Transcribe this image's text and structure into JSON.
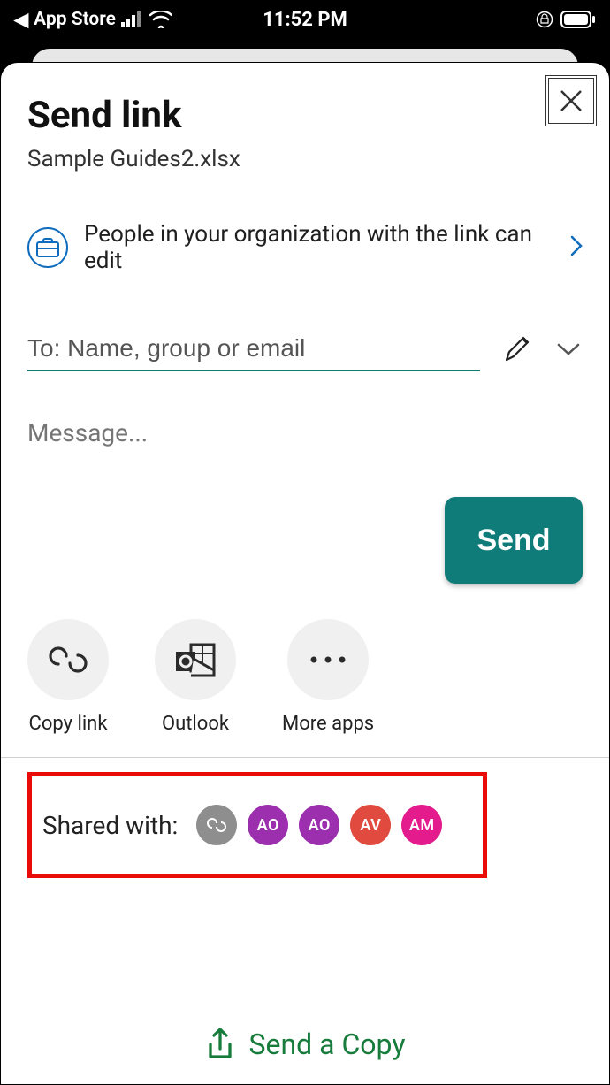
{
  "statusbar": {
    "back_label": "App Store",
    "time": "11:52 PM"
  },
  "sheet": {
    "title": "Send link",
    "filename": "Sample Guides2.xlsx",
    "permission_text": "People in your organization with the link can edit",
    "to_placeholder": "To: Name, group or email",
    "message_placeholder": "Message...",
    "send_label": "Send"
  },
  "actions": {
    "copy_link": "Copy link",
    "outlook": "Outlook",
    "more_apps": "More apps"
  },
  "shared": {
    "label": "Shared with:",
    "avatars": [
      {
        "type": "link",
        "text": "",
        "bg": "#8e8e8e"
      },
      {
        "type": "initials",
        "text": "AO",
        "bg": "#9b2fae"
      },
      {
        "type": "initials",
        "text": "AO",
        "bg": "#9b2fae"
      },
      {
        "type": "initials",
        "text": "AV",
        "bg": "#e14a3f"
      },
      {
        "type": "initials",
        "text": "AM",
        "bg": "#e31b8d"
      }
    ]
  },
  "footer": {
    "send_copy": "Send a Copy"
  }
}
